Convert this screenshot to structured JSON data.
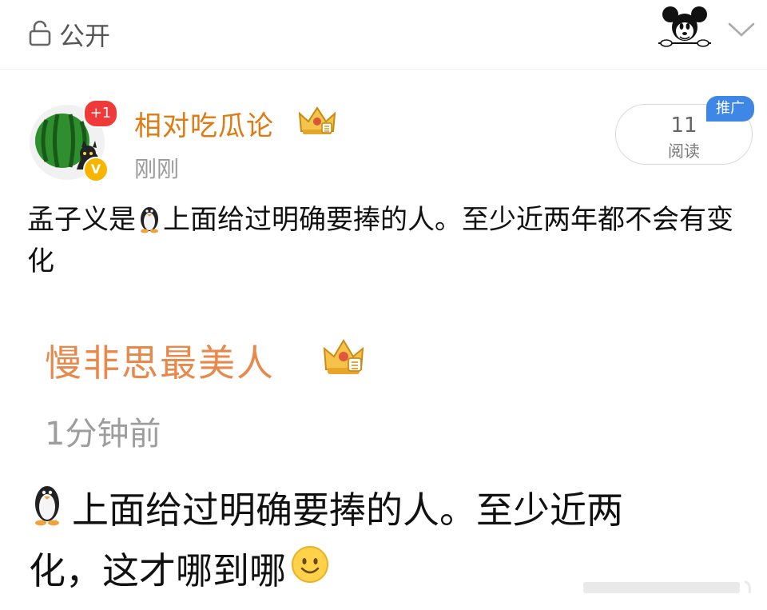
{
  "header": {
    "privacy_label": "公开",
    "icons": {
      "privacy": "lock-icon",
      "mascot": "mickey-mascot-icon",
      "expand": "chevron-down-icon"
    }
  },
  "post": {
    "author": {
      "name": "相对吃瓜论",
      "time": "刚刚",
      "notification_badge": "+1",
      "verified_badge": "V",
      "crown_icon": "crown-icon"
    },
    "stats": {
      "read_count": "11",
      "read_label": "阅读",
      "promo_tag": "推广"
    },
    "content": {
      "part1": "孟子义是",
      "emoji": "penguin-icon",
      "part2": "上面给过明确要捧的人。至少近两年都不会有变化"
    }
  },
  "quoted": {
    "author": "慢非思最美人",
    "time": "1分钟前",
    "crown_icon": "crown-icon",
    "line1": "上面给过明确要捧的人。至少近两",
    "line2": "化，这才哪到哪",
    "emojis": [
      "penguin-icon",
      "smile-icon"
    ]
  },
  "colors": {
    "username": "#e07a12",
    "quote_author": "#e8884a",
    "promo": "#3f87e6",
    "badge": "#f03a3a",
    "verified": "#f7b500"
  }
}
